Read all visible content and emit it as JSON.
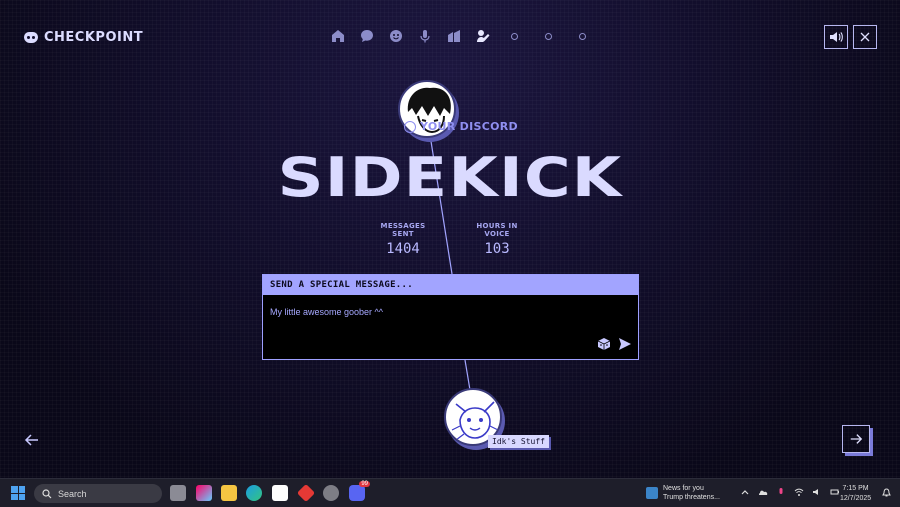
{
  "brand": {
    "name": "CHECKPOINT",
    "icon": "discord-logo-icon"
  },
  "topnav": {
    "items": [
      {
        "icon": "home-icon",
        "active": false
      },
      {
        "icon": "chat-bubble-icon",
        "active": false
      },
      {
        "icon": "emoji-icon",
        "active": false
      },
      {
        "icon": "microphone-icon",
        "active": false
      },
      {
        "icon": "apps-icon",
        "active": false
      },
      {
        "icon": "profile-icon",
        "active": true
      },
      {
        "icon": "dot-icon",
        "active": false
      },
      {
        "icon": "dot-icon",
        "active": false
      },
      {
        "icon": "dot-icon",
        "active": false
      }
    ]
  },
  "controls": {
    "sound_icon": "speaker-icon",
    "close_icon": "close-icon"
  },
  "card": {
    "kicker": "YOUR DISCORD",
    "title": "SIDEKICK",
    "stats": [
      {
        "label": "MESSAGES SENT",
        "value": "1404"
      },
      {
        "label": "HOURS IN VOICE",
        "value": "103"
      }
    ]
  },
  "message": {
    "header": "SEND A SPECIAL MESSAGE...",
    "value": "My little awesome goober ^^"
  },
  "friend": {
    "name": "Idk's Stuff"
  },
  "taskbar": {
    "search_placeholder": "Search",
    "discord_badge": "99",
    "news_title": "News for you",
    "news_headline": "Trump threatens...",
    "time": "7:15 PM",
    "date": "12/7/2025"
  },
  "colors": {
    "accent": "#a2a4ff",
    "background": "#120e2c",
    "text": "#dadaff"
  }
}
